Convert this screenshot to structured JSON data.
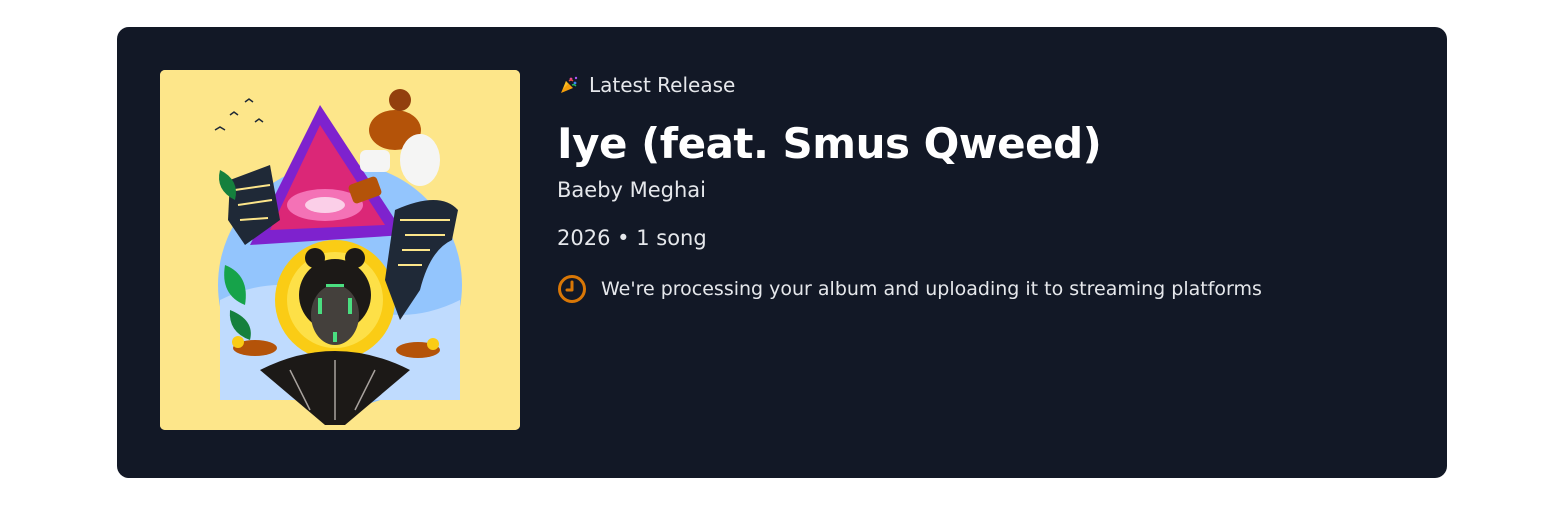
{
  "release": {
    "eyebrow_label": "Latest Release",
    "eyebrow_icon": "party-popper-icon",
    "title": "Iye (feat. Smus Qweed)",
    "artist": "Baeby Meghai",
    "year": "2026",
    "separator": "•",
    "song_count": "1 song",
    "meta_line": "2026 • 1 song",
    "status_icon": "clock-icon",
    "status_text": "We're processing your album and uploading it to streaming platforms"
  },
  "colors": {
    "card_background": "#121826",
    "cover_background": "#fde68a",
    "status_accent": "#d97706",
    "text_primary": "#ffffff",
    "text_secondary": "#e5e7eb"
  }
}
